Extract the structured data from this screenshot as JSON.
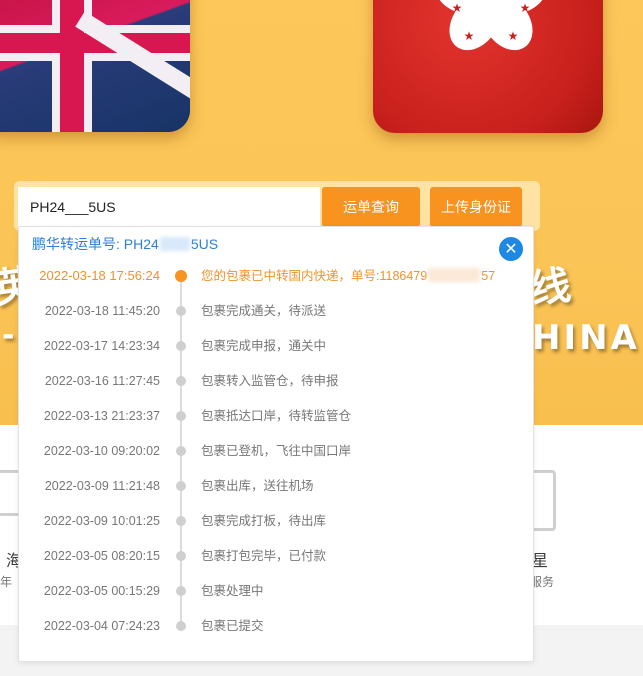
{
  "search": {
    "value": "PH24___5US",
    "query_button": "运单查询",
    "upload_button": "上传身份证"
  },
  "result": {
    "tracking_prefix": "鹏华转运单号: PH24",
    "tracking_suffix": "5US",
    "close_icon": "close-icon",
    "events": [
      {
        "time": "2022-03-18 17:56:24",
        "desc_prefix": "您的包裹已中转国内快递，单号:1186479",
        "desc_suffix": "57",
        "active": true
      },
      {
        "time": "2022-03-18 11:45:20",
        "desc": "包裹完成通关，待派送"
      },
      {
        "time": "2022-03-17 14:23:34",
        "desc": "包裹完成申报，通关中"
      },
      {
        "time": "2022-03-16 11:27:45",
        "desc": "包裹转入监管仓，待申报"
      },
      {
        "time": "2022-03-13 21:23:37",
        "desc": "包裹抵达口岸，待转监管仓"
      },
      {
        "time": "2022-03-10 09:20:02",
        "desc": "包裹已登机，飞往中国口岸"
      },
      {
        "time": "2022-03-09 11:21:48",
        "desc": "包裹出库，送往机场"
      },
      {
        "time": "2022-03-09 10:01:25",
        "desc": "包裹完成打板，待出库"
      },
      {
        "time": "2022-03-05 08:20:15",
        "desc": "包裹打包完毕，已付款"
      },
      {
        "time": "2022-03-05 00:15:29",
        "desc": "包裹处理中"
      },
      {
        "time": "2022-03-04 07:24:23",
        "desc": "包裹已提交"
      }
    ]
  },
  "hero": {
    "deco_left": "英",
    "deco_right": "线",
    "deco_china": "HINA"
  },
  "services": {
    "left_title": "海",
    "left_sub": "年",
    "right_title": "星",
    "right_sub": "输服务"
  },
  "colors": {
    "accent": "#f7931e",
    "link": "#2b7fd6",
    "hero_bg": "#fbc456"
  }
}
